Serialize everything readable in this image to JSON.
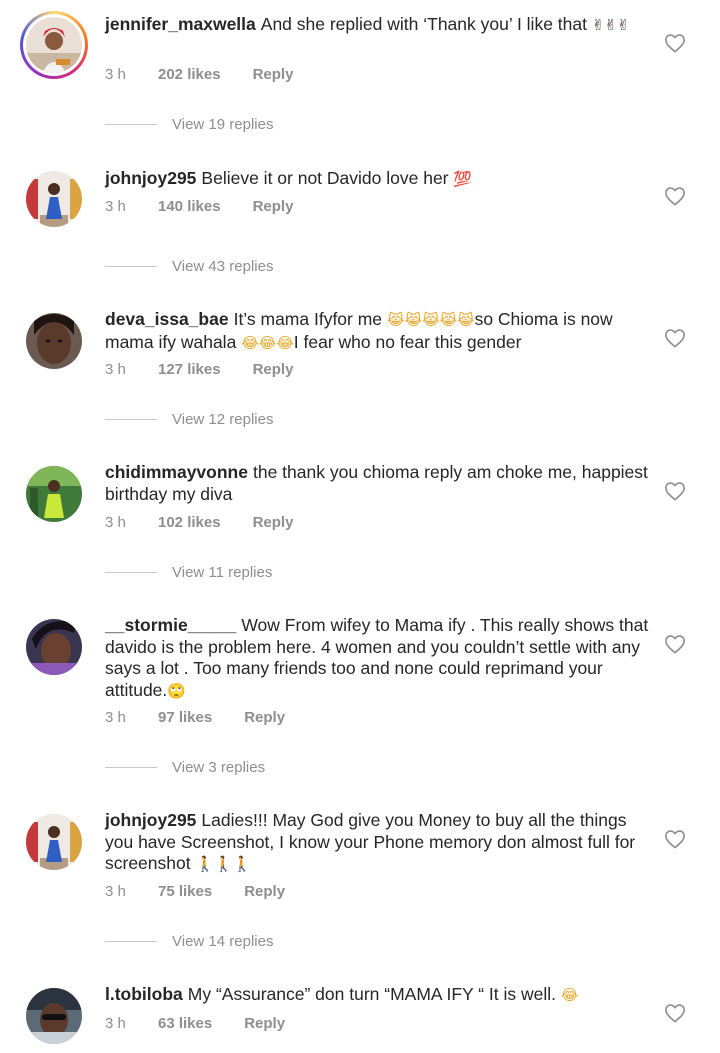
{
  "comments": [
    {
      "username": "jennifer_maxwella",
      "text": "And she replied with ‘Thank you’ I like that",
      "emoji": "✌✌✌",
      "time": "3 h",
      "likes": "202 likes",
      "reply": "Reply",
      "view_replies": "View 19 replies",
      "avatar_icon": "avatar-with-story-ring"
    },
    {
      "username": "johnjoy295",
      "text": "Believe it or not Davido love her",
      "emoji": "💯",
      "time": "3 h",
      "likes": "140 likes",
      "reply": "Reply",
      "view_replies": "View 43 replies"
    },
    {
      "username": "deva_issa_bae",
      "text": "It’s mama Ifyfor me",
      "emoji": "😹😹😹😹😹",
      "text2": "so Chioma is now mama ify wahala",
      "emoji2": "😂😂😂",
      "text3": "I fear who no fear this gender",
      "time": "3 h",
      "likes": "127 likes",
      "reply": "Reply",
      "view_replies": "View 12 replies"
    },
    {
      "username": "chidimmayvonne",
      "text": "the thank you chioma reply am choke me, happiest birthday my diva",
      "time": "3 h",
      "likes": "102 likes",
      "reply": "Reply",
      "view_replies": "View 11 replies"
    },
    {
      "username": "__stormie_____",
      "text": "Wow From wifey  to Mama ify . This really shows that davido is the problem here. 4 women and you couldn’t settle with any says a lot . Too many friends too and none could reprimand your attitude.",
      "emoji": "🙄",
      "time": "3 h",
      "likes": "97 likes",
      "reply": "Reply",
      "view_replies": "View 3 replies"
    },
    {
      "username": "johnjoy295",
      "text": "Ladies!!! May God give you Money to buy all the things you have Screenshot, I know your Phone memory don almost full for screenshot",
      "emoji": "🚶🚶🚶",
      "time": "3 h",
      "likes": "75 likes",
      "reply": "Reply",
      "view_replies": "View 14 replies"
    },
    {
      "username": "l.tobiloba",
      "text": "My “Assurance” don turn “MAMA IFY “ It is well.",
      "emoji": "😂",
      "time": "3 h",
      "likes": "63 likes",
      "reply": "Reply"
    }
  ],
  "colors": {
    "text": "#262626",
    "secondary": "#8e8e8e",
    "divider": "#c7c7c7"
  },
  "icons": {
    "like": "heart-outline-icon"
  }
}
